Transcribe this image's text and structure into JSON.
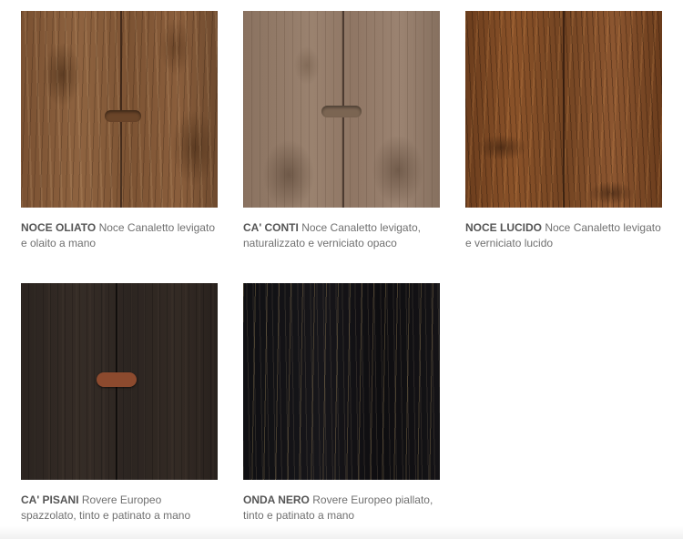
{
  "swatches": [
    {
      "name": "NOCE OLIATO",
      "desc": "Noce Canaletto levigato e olaito a mano"
    },
    {
      "name": "CA' CONTI",
      "desc": "Noce Canaletto levigato, naturalizzato e verniciato opaco"
    },
    {
      "name": "NOCE LUCIDO",
      "desc": "Noce Canaletto levigato e verniciato lucido"
    },
    {
      "name": "CA' PISANI",
      "desc": "Rovere Europeo spazzolato, tinto e patinato a mano"
    },
    {
      "name": "ONDA NERO",
      "desc": "Rovere Europeo piallato, tinto e patinato a mano"
    }
  ]
}
